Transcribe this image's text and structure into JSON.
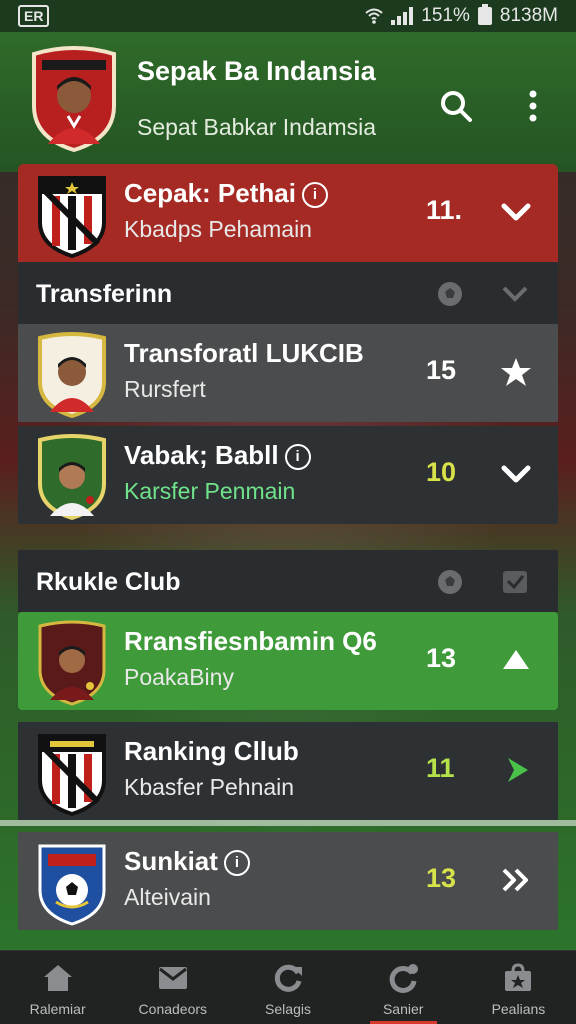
{
  "status_bar": {
    "left_label": "ER",
    "battery": "151%",
    "extra": "8138M"
  },
  "header": {
    "title": "Sepak Ba Indansia",
    "subtitle": "Sepat Babkar Indamsia"
  },
  "highlight_row": {
    "name": "Cepak: Pethai",
    "sub": "Kbadps Pehamain",
    "score": "11.",
    "action_icon": "chevron-down-icon",
    "color": "#a52a24"
  },
  "sections": [
    {
      "title": "Transferinn",
      "rows": [
        {
          "name": "Transforatl LUKCIB",
          "sub": "Rursfert",
          "score": "15",
          "score_color": "#ffffff",
          "sub_color": "#e8e8e8",
          "info": false,
          "action_icon": "star-icon"
        },
        {
          "name": "Vabak; Babll",
          "sub": "Karsfer Penmain",
          "score": "10",
          "score_color": "#d8e34a",
          "sub_color": "#6fe38b",
          "info": true,
          "action_icon": "chevron-down-icon"
        }
      ]
    },
    {
      "title": "Rkukle Club",
      "rows": [
        {
          "name": "Rransfiesnbamin Q6",
          "sub": "PoakaBiny",
          "score": "13",
          "score_color": "#ffffff",
          "sub_color": "#f0f0f0",
          "info": false,
          "action_icon": "chevron-up-icon"
        },
        {
          "name": "Ranking Cllub",
          "sub": "Kbasfer Pehnain",
          "score": "11",
          "score_color": "#b6e34a",
          "sub_color": "#e8e8e8",
          "info": false,
          "action_icon": "arrow-right-icon"
        },
        {
          "name": "Sunkiat",
          "sub": "Alteivain",
          "score": "13",
          "score_color": "#d8e34a",
          "sub_color": "#e8e8e8",
          "info": true,
          "action_icon": "double-chevron-right-icon"
        }
      ]
    }
  ],
  "bottom_nav": [
    {
      "label": "Ralemiar",
      "icon": "home-icon"
    },
    {
      "label": "Conadeors",
      "icon": "inbox-icon"
    },
    {
      "label": "Selagis",
      "icon": "refresh-icon"
    },
    {
      "label": "Sanier",
      "icon": "trophy-icon",
      "active": true
    },
    {
      "label": "Pealians",
      "icon": "bag-icon"
    }
  ],
  "colors": {
    "header_green": "#2f6b2a",
    "highlight_red": "#a52a24",
    "active_green": "#3f9a3a",
    "row_dark": "#2e3133",
    "row_grey": "#4a4c4d"
  }
}
